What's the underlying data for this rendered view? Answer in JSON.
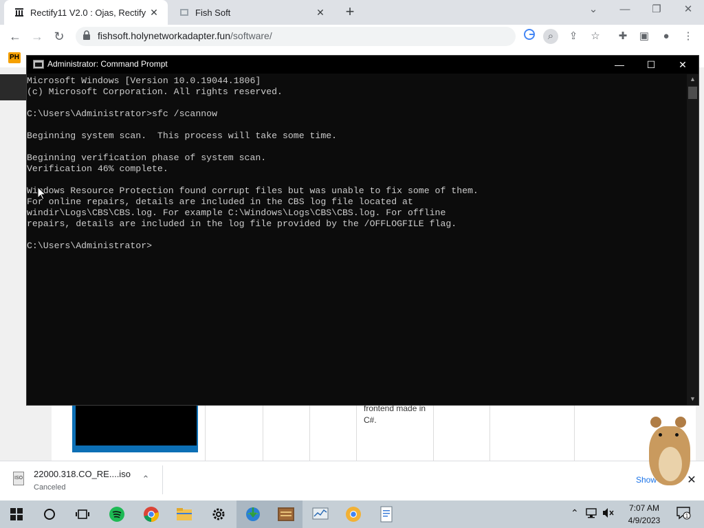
{
  "browser": {
    "tabs": [
      {
        "title": "Rectify11 V2.0 : Ojas, Rectify1",
        "active": true
      },
      {
        "title": "Fish Soft",
        "active": false
      }
    ],
    "url_host": "fishsoft.holynetworkadapter.fun",
    "url_path": "/software/",
    "bookmark_label": "PH"
  },
  "cmd": {
    "title": "Administrator: Command Prompt",
    "lines": [
      "Microsoft Windows [Version 10.0.19044.1806]",
      "(c) Microsoft Corporation. All rights reserved.",
      "",
      "C:\\Users\\Administrator>sfc /scannow",
      "",
      "Beginning system scan.  This process will take some time.",
      "",
      "Beginning verification phase of system scan.",
      "Verification 46% complete.",
      "",
      "Windows Resource Protection found corrupt files but was unable to fix some of them.",
      "For online repairs, details are included in the CBS log file located at",
      "windir\\Logs\\CBS\\CBS.log. For example C:\\Windows\\Logs\\CBS\\CBS.log. For offline",
      "repairs, details are included in the log file provided by the /OFFLOGFILE flag.",
      "",
      "C:\\Users\\Administrator>"
    ]
  },
  "page": {
    "cell_text": "frontend made in C#."
  },
  "downloads": {
    "file_name": "22000.318.CO_RE....iso",
    "status": "Canceled",
    "show_all": "Show all",
    "file_icon_label": "ISO"
  },
  "taskbar": {
    "time": "7:07 AM",
    "date": "4/9/2023",
    "notification_count": "1"
  }
}
